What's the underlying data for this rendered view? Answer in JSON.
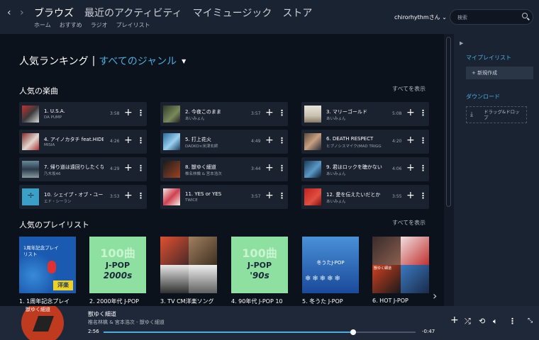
{
  "nav": {
    "back": "‹",
    "forward": "›",
    "main": [
      "ブラウズ",
      "最近のアクティビティ",
      "マイミュージック",
      "ストア"
    ],
    "sub": [
      "ホーム",
      "おすすめ",
      "ラジオ",
      "プレイリスト"
    ]
  },
  "user": "chirorhythmさん",
  "search_placeholder": "検索",
  "ranking": {
    "title": "人気ランキング",
    "sep": "|",
    "genre": "すべてのジャンル"
  },
  "songs_section": {
    "title": "人気の楽曲",
    "see_all": "すべてを表示"
  },
  "songs": [
    {
      "title": "1. U.S.A.",
      "artist": "DA PUMP",
      "dur": "3:58"
    },
    {
      "title": "2. 今夜このまま",
      "artist": "あいみょん",
      "dur": "3:57"
    },
    {
      "title": "3. マリーゴールド",
      "artist": "あいみょん",
      "dur": "5:08"
    },
    {
      "title": "4. アイノカタチ feat.HIDE",
      "artist": "MISIA",
      "dur": "4:26"
    },
    {
      "title": "5. 打上花火",
      "artist": "DAOKO×米津玄師",
      "dur": "4:49"
    },
    {
      "title": "6. DEATH RESPECT",
      "artist": "ヒプノシスマイク(MAD TRIGG",
      "dur": "4:20"
    },
    {
      "title": "7. 帰り道は遠回りしたくな",
      "artist": "乃木坂46",
      "dur": "4:29"
    },
    {
      "title": "8. 獣ゆく細道",
      "artist": "椎名林檎 & 宮本浩次",
      "dur": "3:44"
    },
    {
      "title": "9. 君はロックを聴かない",
      "artist": "あいみょん",
      "dur": "4:06"
    },
    {
      "title": "10. シェイプ・オブ・ユー",
      "artist": "エド・シーラン",
      "dur": "3:53"
    },
    {
      "title": "11. YES or YES",
      "artist": "TWICE",
      "dur": "3:57"
    },
    {
      "title": "12. 愛を伝えたいだとか",
      "artist": "あいみょん",
      "dur": "3:55"
    }
  ],
  "playlists_section": {
    "title": "人気のプレイリスト",
    "see_all": "すべてを表示"
  },
  "playlists": [
    {
      "caption": "1. 1周年記念プレイ",
      "art_text": "1周年記念プレイリスト",
      "badge": "洋楽"
    },
    {
      "caption": "2. 2000年代 J-POP",
      "art_big": "100曲",
      "art_text": "J-POP",
      "art_sub": "2000s"
    },
    {
      "caption": "3. TV CM洋楽ソング"
    },
    {
      "caption": "4. 90年代 J-POP 10",
      "art_big": "100曲",
      "art_text": "J-POP",
      "art_sub": "'90s"
    },
    {
      "caption": "5. 冬うた J-POP",
      "art_text": "冬うたJ-POP"
    },
    {
      "caption": "6. HOT J-POP",
      "art_text": "獣ゆく細道"
    }
  ],
  "sidebar": {
    "my_playlist": "マイプレイリスト",
    "new": "新規作成",
    "download": "ダウンロード",
    "drop": "ドラッグ&ドロップ"
  },
  "player": {
    "title": "獣ゆく細道",
    "artist": "椎名林檎 & 宮本浩次 - 獣ゆく細道",
    "art_text": "獣ゆく細道",
    "elapsed": "2:56",
    "remaining": "-0:47",
    "progress": 0.8
  },
  "colors": {
    "accent": "#4aaee0"
  }
}
